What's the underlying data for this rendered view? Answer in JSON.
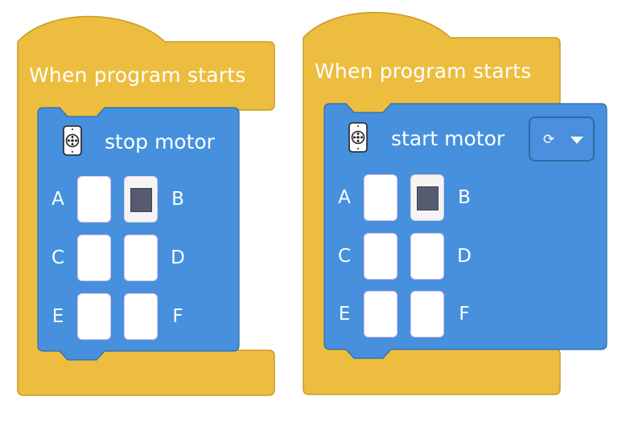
{
  "scripts": [
    {
      "hat": {
        "title": "When program starts"
      },
      "block": {
        "label": "stop motor",
        "icon": "motor-icon",
        "ports": [
          {
            "letter": "A",
            "selected": false
          },
          {
            "letter": "B",
            "selected": true
          },
          {
            "letter": "C",
            "selected": false
          },
          {
            "letter": "D",
            "selected": false
          },
          {
            "letter": "E",
            "selected": false
          },
          {
            "letter": "F",
            "selected": false
          }
        ]
      }
    },
    {
      "hat": {
        "title": "When program starts"
      },
      "block": {
        "label": "start motor",
        "icon": "motor-icon",
        "direction": {
          "icon": "clockwise-icon",
          "symbol": "⟳"
        },
        "ports": [
          {
            "letter": "A",
            "selected": false
          },
          {
            "letter": "B",
            "selected": true
          },
          {
            "letter": "C",
            "selected": false
          },
          {
            "letter": "D",
            "selected": false
          },
          {
            "letter": "E",
            "selected": false
          },
          {
            "letter": "F",
            "selected": false
          }
        ]
      }
    }
  ],
  "colors": {
    "event_hat": "#ecbd3f",
    "event_hat_border": "#c99b22",
    "motor_block": "#4690de",
    "motor_block_border": "#2f6ba3",
    "port_selected": "#575b70"
  }
}
